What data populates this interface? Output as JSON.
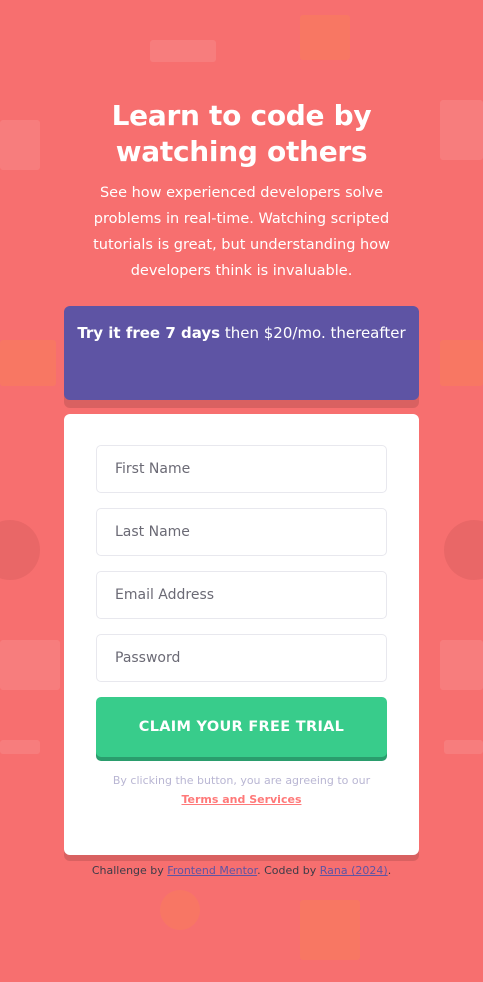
{
  "hero": {
    "title_line1": "Learn to code by",
    "title_line2": "watching others",
    "description": "See how experienced developers solve problems in real-time. Watching scripted tutorials is great, but understanding how developers think is invaluable."
  },
  "promo": {
    "highlight": "Try it free 7 days",
    "rest": " then $20/mo. thereafter"
  },
  "form": {
    "first_name_placeholder": "First Name",
    "last_name_placeholder": "Last Name",
    "email_placeholder": "Email Address",
    "password_placeholder": "Password",
    "submit_label": "CLAIM YOUR FREE TRIAL",
    "terms_text": "By clicking the button, you are agreeing to our",
    "terms_link": "Terms and Services"
  },
  "footer": {
    "prefix": "Challenge by ",
    "frontend_mentor": "Frontend Mentor",
    "middle": ". Coded by ",
    "author": "Rana (2024)",
    "suffix": "."
  },
  "colors": {
    "background": "#f76f6f",
    "promo": "#5e54a4",
    "cta": "#38cc8b",
    "terms_link": "#ff7979"
  }
}
